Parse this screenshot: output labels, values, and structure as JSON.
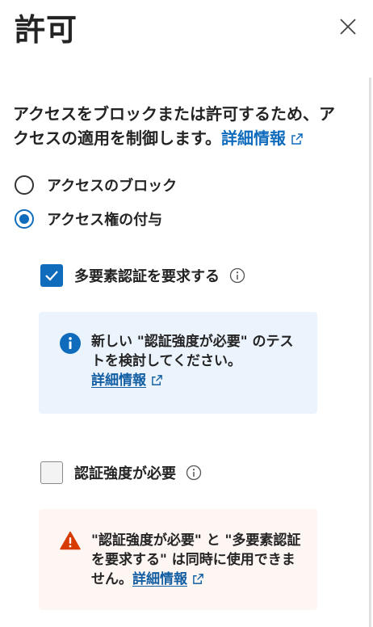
{
  "header": {
    "title": "許可"
  },
  "description": {
    "text": "アクセスをブロックまたは許可するため、アクセスの適用を制御します。",
    "link": "詳細情報"
  },
  "access": {
    "options": [
      {
        "label": "アクセスのブロック",
        "selected": false
      },
      {
        "label": "アクセス権の付与",
        "selected": true
      }
    ]
  },
  "controls": {
    "mfa": {
      "label": "多要素認証を要求する",
      "checked": true
    },
    "strength": {
      "label": "認証強度が必要",
      "checked": false
    }
  },
  "info_box": {
    "text": "新しい \"認証強度が必要\" のテストを検討してください。",
    "link": "詳細情報"
  },
  "warning_box": {
    "text": "\"認証強度が必要\" と \"多要素認証を要求する\" は同時に使用できません。",
    "link": "詳細情報"
  },
  "colors": {
    "accent": "#0f6cbd",
    "warning": "#d83b01",
    "info_bg": "#ebf3fc",
    "warning_bg": "#fdf6f3"
  }
}
